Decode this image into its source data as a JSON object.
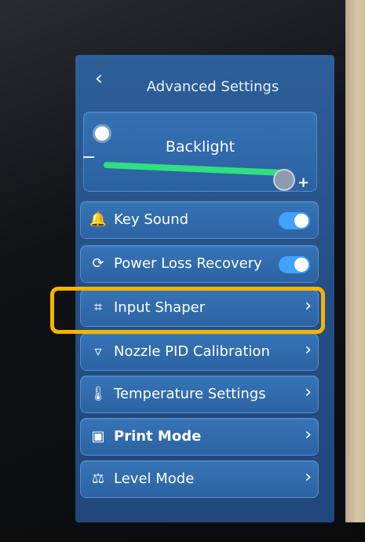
{
  "header": {
    "title": "Advanced Settings",
    "back_icon": "back-chevron-icon"
  },
  "backlight": {
    "label": "Backlight",
    "minus": "−",
    "plus": "+",
    "level": 0.92,
    "accent": "#2ee07f"
  },
  "rows": [
    {
      "label": "Key Sound",
      "icon": "bell-icon",
      "control": "toggle",
      "on": true
    },
    {
      "label": "Power Loss Recovery",
      "icon": "power-recovery-icon",
      "control": "toggle",
      "on": true
    },
    {
      "label": "Input Shaper",
      "icon": "input-shaper-icon",
      "control": "chevron"
    },
    {
      "label": "Nozzle PID Calibration",
      "icon": "nozzle-icon",
      "control": "chevron"
    },
    {
      "label": "Temperature Settings",
      "icon": "thermometer-icon",
      "control": "chevron"
    },
    {
      "label": "Print Mode",
      "icon": "print-mode-icon",
      "control": "chevron"
    },
    {
      "label": "Level Mode",
      "icon": "scale-icon",
      "control": "chevron"
    }
  ],
  "highlight_color": "#f4b400"
}
